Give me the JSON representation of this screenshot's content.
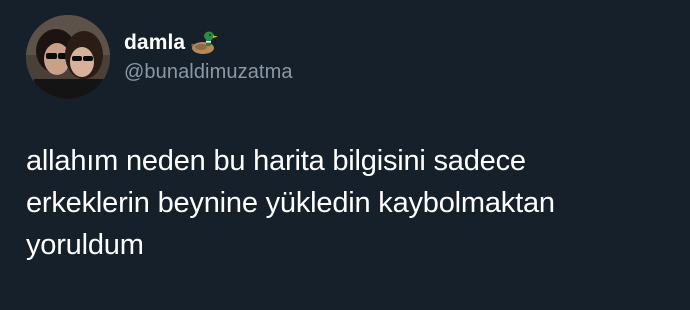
{
  "tweet": {
    "author": {
      "display_name": "damla",
      "name_emoji": "duck-icon",
      "handle": "@bunaldimuzatma"
    },
    "text_lines": [
      "allahım neden bu harita bilgisini sadece",
      "erkeklerin beynine yükledin kaybolmaktan",
      "yoruldum"
    ]
  },
  "colors": {
    "background": "#15202b",
    "primary_text": "#ffffff",
    "secondary_text": "#8b98a5"
  }
}
